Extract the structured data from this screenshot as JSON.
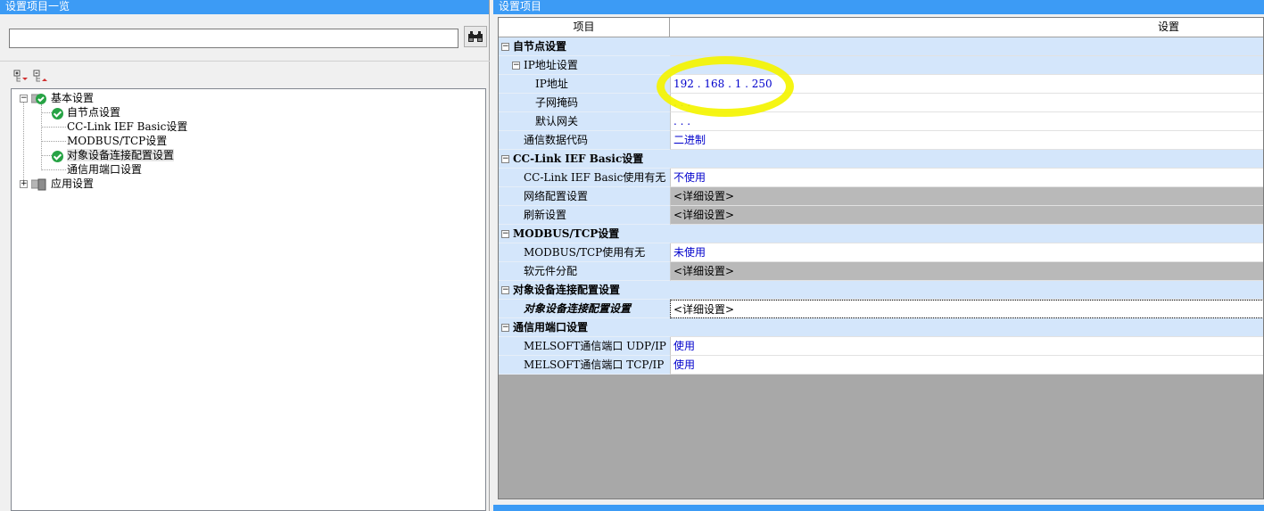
{
  "left_panel": {
    "title": "设置项目一览",
    "search": {
      "value": "",
      "placeholder": ""
    },
    "find_icon": "binoculars-icon",
    "tree": {
      "basic": "基本设置",
      "own_node": "自节点设置",
      "cclink": "CC-Link IEF Basic设置",
      "modbus": "MODBUS/TCP设置",
      "target_conn": "对象设备连接配置设置",
      "comm_port": "通信用端口设置",
      "app": "应用设置"
    }
  },
  "right_panel": {
    "title": "设置项目",
    "headers": {
      "item": "项目",
      "setting": "设置"
    },
    "rows": {
      "own_node_group": "自节点设置",
      "ip_group": "IP地址设置",
      "ip_label": "IP地址",
      "ip_value": "192 . 168 .  1 . 250",
      "subnet_label": "子网掩码",
      "subnet_value": " .    .    .",
      "gateway_label": "默认网关",
      "gateway_value": " .    .    .",
      "datacode_label": "通信数据代码",
      "datacode_value": "二进制",
      "cclink_group": "CC-Link IEF Basic设置",
      "cclink_use_label": "CC-Link IEF Basic使用有无",
      "cclink_use_value": "不使用",
      "network_label": "网络配置设置",
      "network_value": "<详细设置>",
      "refresh_label": "刷新设置",
      "refresh_value": "<详细设置>",
      "modbus_group": "MODBUS/TCP设置",
      "modbus_use_label": "MODBUS/TCP使用有无",
      "modbus_use_value": "未使用",
      "device_label": "软元件分配",
      "device_value": "<详细设置>",
      "target_group": "对象设备连接配置设置",
      "target_label": "对象设备连接配置设置",
      "target_value": "<详细设置>",
      "port_group": "通信用端口设置",
      "udp_label": "MELSOFT通信端口  UDP/IP",
      "udp_value": "使用",
      "tcp_label": "MELSOFT通信端口  TCP/IP",
      "tcp_value": "使用"
    }
  },
  "colors": {
    "title_bar": "#3c9bf5",
    "group_bg": "#d4e6fb",
    "highlight": "#f4f400",
    "value_link": "#0000cc"
  }
}
